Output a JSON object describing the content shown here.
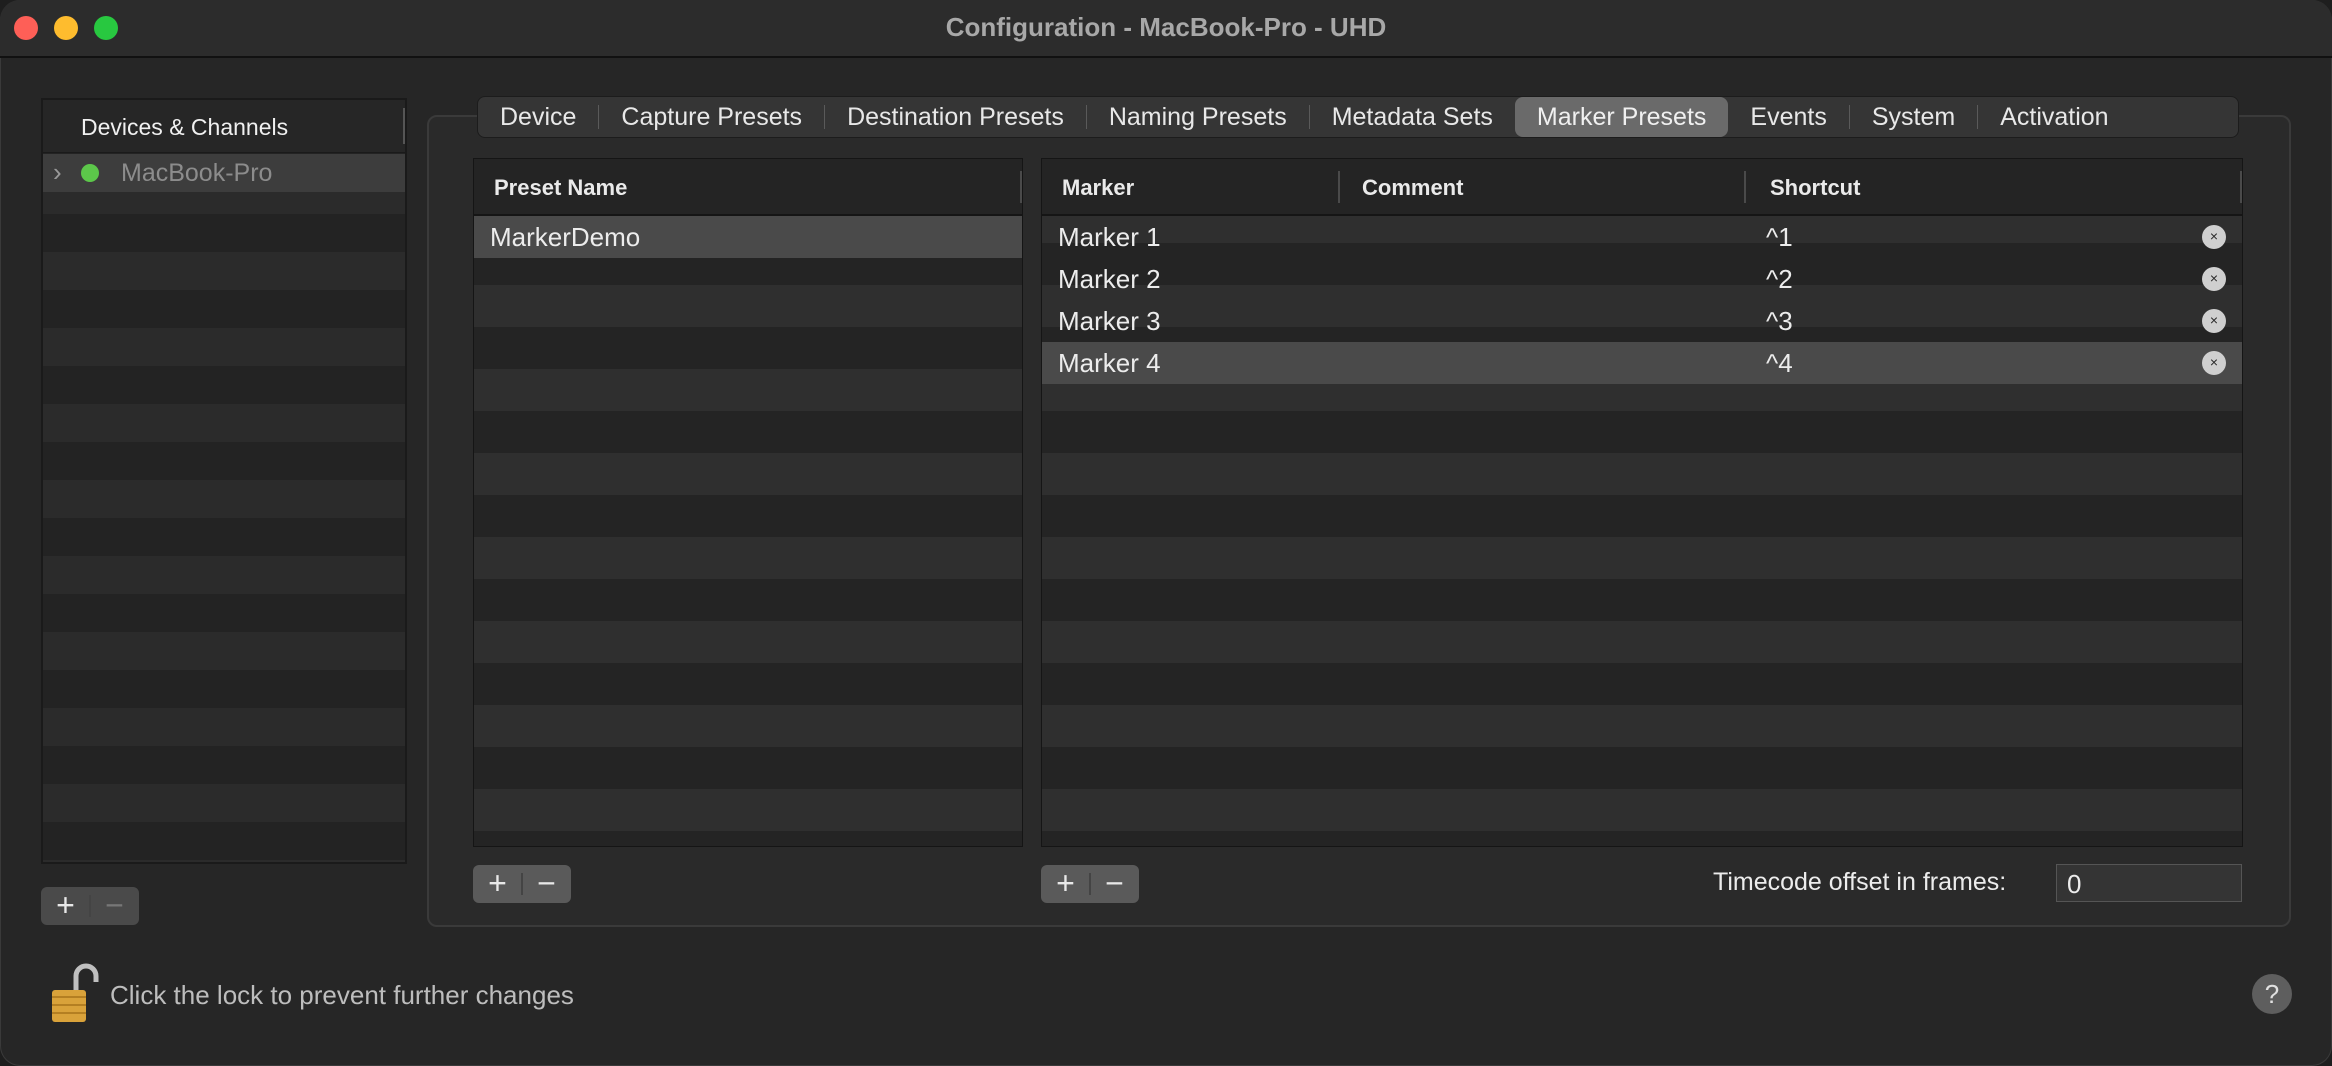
{
  "window": {
    "title": "Configuration - MacBook-Pro - UHD"
  },
  "sidebar": {
    "header": "Devices & Channels",
    "items": [
      {
        "label": "MacBook-Pro",
        "status": "green"
      }
    ],
    "add_label": "+",
    "remove_label": "−"
  },
  "tabs": [
    {
      "label": "Device"
    },
    {
      "label": "Capture Presets"
    },
    {
      "label": "Destination Presets"
    },
    {
      "label": "Naming Presets"
    },
    {
      "label": "Metadata Sets"
    },
    {
      "label": "Marker Presets",
      "active": true
    },
    {
      "label": "Events"
    },
    {
      "label": "System"
    },
    {
      "label": "Activation"
    }
  ],
  "presets": {
    "column_header": "Preset Name",
    "rows": [
      "MarkerDemo"
    ],
    "add_label": "+",
    "remove_label": "−"
  },
  "markers": {
    "columns": {
      "marker": "Marker",
      "comment": "Comment",
      "shortcut": "Shortcut"
    },
    "rows": [
      {
        "marker": "Marker 1",
        "comment": "",
        "shortcut": "^1"
      },
      {
        "marker": "Marker 2",
        "comment": "",
        "shortcut": "^2"
      },
      {
        "marker": "Marker 3",
        "comment": "",
        "shortcut": "^3"
      },
      {
        "marker": "Marker 4",
        "comment": "",
        "shortcut": "^4"
      }
    ],
    "clear_glyph": "×",
    "add_label": "+",
    "remove_label": "−"
  },
  "timecode": {
    "label": "Timecode offset in frames:",
    "value": "0"
  },
  "footer": {
    "lock_text": "Click the lock to prevent further changes",
    "help_label": "?"
  }
}
